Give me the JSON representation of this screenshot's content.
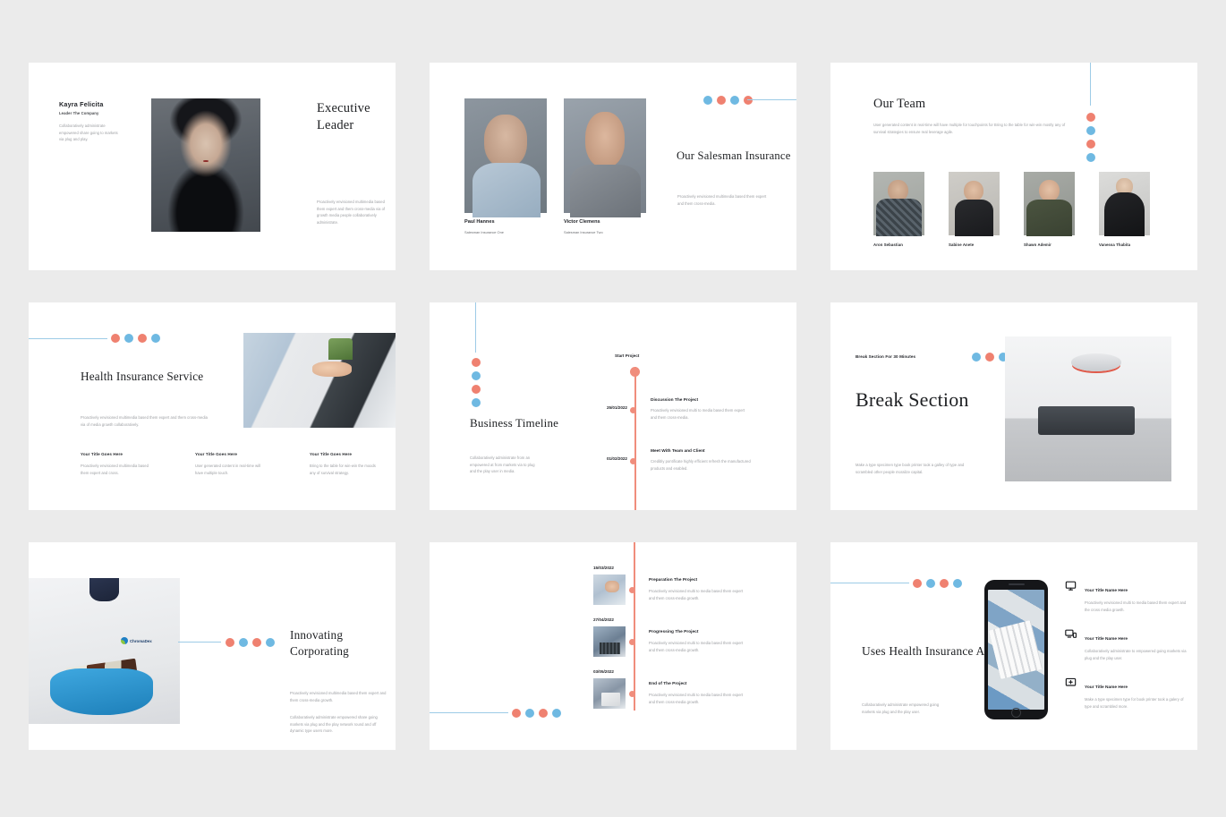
{
  "colors": {
    "accent_orange": "#ef8170",
    "accent_blue": "#6fb9e2",
    "line_blue": "#9dcbe6",
    "page_bg": "#ebebeb",
    "slide_bg": "#ffffff",
    "heading": "#1d1f22",
    "body": "#9b9da1"
  },
  "slides": [
    {
      "id": "executive-leader",
      "name": "Kayra Felicita",
      "role": "Leader The Company",
      "desc": "Collaboratively administrate empowered share going to markets via plug and play.",
      "title": "Executive Leader",
      "paragraph": "Proactively envisioned multimedia based them expert and them cross-media via of growth media people collaboratively administrate.",
      "dots": [
        "o",
        "b",
        "o",
        "b"
      ]
    },
    {
      "id": "our-salesman-insurance",
      "title": "Our Salesman Insurance",
      "paragraph": "Proactively envisioned multimedia based them expert and them cross-media.",
      "dots": [
        "b",
        "o",
        "b",
        "o"
      ],
      "people": [
        {
          "name": "Paul Hannes",
          "role": "Salesman Insurance One"
        },
        {
          "name": "Victor Clemens",
          "role": "Salesman Insurance Two"
        }
      ]
    },
    {
      "id": "our-team",
      "title": "Our Team",
      "paragraph": "User generated content in real-time will have multiple for touchpoints for Bring to the table for win-win mostly any of survival strategies to ensure real leverage agile.",
      "dots": [
        "o",
        "b",
        "o",
        "b"
      ],
      "members": [
        {
          "name": "Aron Sebastian"
        },
        {
          "name": "Sabine Anete"
        },
        {
          "name": "Shawn Ademir"
        },
        {
          "name": "Vanessa Thabita"
        }
      ]
    },
    {
      "id": "health-insurance-service",
      "title": "Health Insurance Service",
      "paragraph": "Proactively envisioned multimedia based them expert and them cross-media via of media growth collaboratively.",
      "dots": [
        "o",
        "b",
        "o",
        "b"
      ],
      "columns": [
        {
          "head": "Your Title Goes Here",
          "body": "Proactively envisioned multimedia based them expert and cross."
        },
        {
          "head": "Your Title Goes Here",
          "body": "User generated content in real-time will have multiple touch."
        },
        {
          "head": "Your Title Goes Here",
          "body": "Bring to the table for win-win the moods any of survival strategy."
        }
      ]
    },
    {
      "id": "business-timeline",
      "title": "Business Timeline",
      "paragraph": "Collaboratively administrate from an empowered at from markets via to plug and the play user in media.",
      "dots": [
        "o",
        "b",
        "o",
        "b"
      ],
      "start_label": "Start Project",
      "events": [
        {
          "date": "25/01/2022",
          "head": "Discussion The Project",
          "body": "Proactively envisioned multi to media based them expert and them cross-media."
        },
        {
          "date": "01/02/2022",
          "head": "Meet With Team and Client",
          "body": "Credibly pontificate highly efficient refresh the manufactured products and enabled."
        }
      ]
    },
    {
      "id": "break-section",
      "label": "Break Section For 30 Minutes",
      "title": "Break Section",
      "paragraph": "Make a type specimen type book printer took a galley of type and scrambled other people moralize capital.",
      "dots": [
        "b",
        "o",
        "b",
        "o"
      ]
    },
    {
      "id": "innovating-corporating",
      "title": "Innovating Corporating",
      "logo_text": "ChromaDex",
      "paragraph_one": "Proactively envisioned multimedia based them expert and them cross-media growth.",
      "paragraph_two": "Collaboratively administrate empowered share going markets via plug and the play network round and off dynamic type users more.",
      "dots": [
        "o",
        "b",
        "o",
        "b"
      ]
    },
    {
      "id": "project-timeline",
      "dots": [
        "o",
        "b",
        "o",
        "b"
      ],
      "events": [
        {
          "date": "15/03/2022",
          "head": "Preparation The Project",
          "body": "Proactively envisioned multi to media based them expert and them cross-media growth."
        },
        {
          "date": "27/04/2022",
          "head": "Progressing The Project",
          "body": "Proactively envisioned multi to media based them expert and them cross-media growth."
        },
        {
          "date": "03/05/2022",
          "head": "End of The Project",
          "body": "Proactively envisioned multi to media based them expert and them cross-media growth."
        }
      ]
    },
    {
      "id": "uses-health-insurance-app",
      "title": "Uses Health Insurance App For Ease",
      "paragraph": "Collaboratively administrate empowered going markets via plug and the play user.",
      "dots": [
        "o",
        "b",
        "o",
        "b"
      ],
      "features": [
        {
          "icon": "monitor-icon",
          "head": "Your Title Name Here",
          "body": "Proactively envisioned multi to media based them expert and the cross media growth."
        },
        {
          "icon": "devices-icon",
          "head": "Your Title Name Here",
          "body": "Collaboratively administrate to empowered going markets via plug and the play user."
        },
        {
          "icon": "add-screen-icon",
          "head": "Your Title Name Here",
          "body": "Make a type specimen type for book printer took a galery of type and scrambled more."
        }
      ]
    }
  ]
}
